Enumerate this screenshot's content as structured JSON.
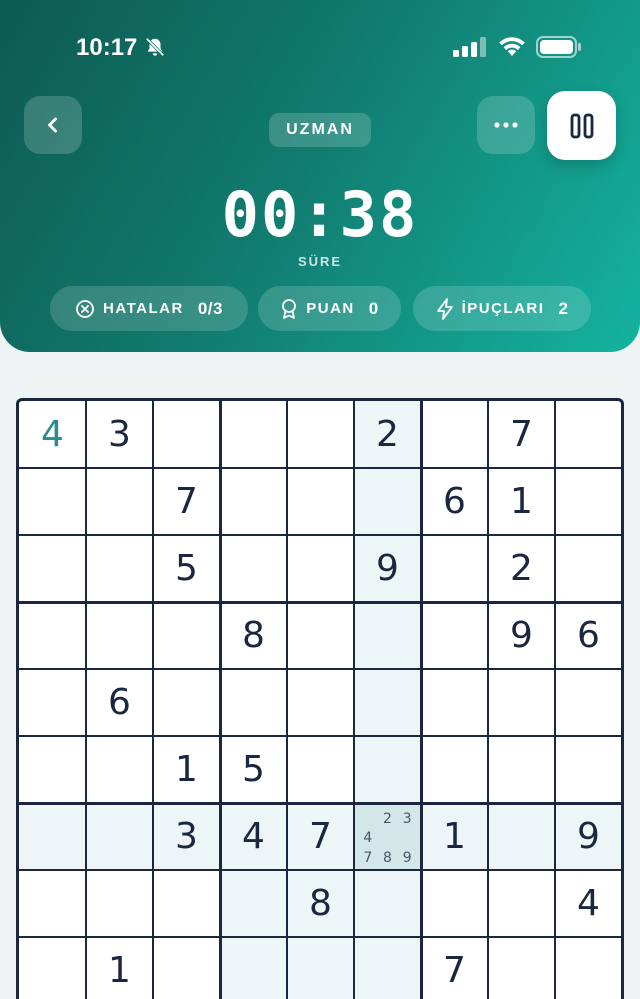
{
  "status_bar": {
    "time": "10:17"
  },
  "header": {
    "difficulty": "UZMAN",
    "timer": "00:38",
    "timer_label": "SÜRE",
    "stats": {
      "mistakes_label": "HATALAR",
      "mistakes_value": "0/3",
      "score_label": "PUAN",
      "score_value": "0",
      "hints_label": "İPUÇLARI",
      "hints_value": "2"
    }
  },
  "colors": {
    "header_start": "#0d5a52",
    "header_end": "#14b3a0",
    "accent_user": "#2a8c8f",
    "board_line": "#1b2640"
  },
  "board": {
    "selected_cell": [
      6,
      5
    ],
    "rows": [
      [
        "4",
        "3",
        "",
        "",
        "",
        "2",
        "",
        "7",
        ""
      ],
      [
        "",
        "",
        "7",
        "",
        "",
        "",
        "6",
        "1",
        ""
      ],
      [
        "",
        "",
        "5",
        "",
        "",
        "9",
        "",
        "2",
        ""
      ],
      [
        "",
        "",
        "",
        "8",
        "",
        "",
        "",
        "9",
        "6"
      ],
      [
        "",
        "6",
        "",
        "",
        "",
        "",
        "",
        "",
        ""
      ],
      [
        "",
        "",
        "1",
        "5",
        "",
        "",
        "",
        "",
        ""
      ],
      [
        "",
        "",
        "3",
        "4",
        "7",
        "",
        "1",
        "",
        "9"
      ],
      [
        "",
        "",
        "",
        "",
        "8",
        "",
        "",
        "",
        "4"
      ],
      [
        "",
        "1",
        "",
        "",
        "",
        "",
        "7",
        "",
        ""
      ]
    ],
    "user_cells": [
      [
        0,
        0
      ]
    ],
    "notes": {
      "6-5": [
        "",
        "2",
        "3",
        "4",
        "",
        "",
        "7",
        "8",
        "9"
      ]
    }
  }
}
